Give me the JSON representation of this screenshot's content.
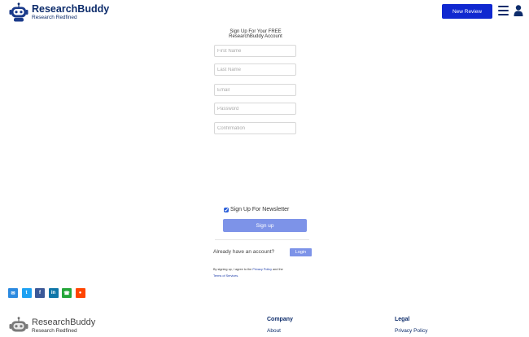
{
  "header": {
    "brand_name": "ResearchBuddy",
    "brand_tagline": "Research Redfined",
    "new_review_label": "New Review",
    "icons": [
      "robot-logo-icon",
      "hamburger-menu-icon",
      "user-icon"
    ]
  },
  "form": {
    "title_line1": "Sign Up For Your FREE",
    "title_line2": "ResearchBuddy Account",
    "fields": {
      "first_name": "First Name",
      "last_name": "Last Name",
      "email": "Email",
      "password": "Password",
      "confirmation": "Confirmation"
    },
    "newsletter_label": "Sign Up For Newsletter",
    "newsletter_checked": true,
    "signup_label": "Sign up",
    "have_account": "Already have an account?",
    "login_label": "Login",
    "terms_prefix": "By signing up, I agree to the",
    "privacy_link": "Privacy Policy",
    "terms_and": "and the",
    "terms_link": "Terms of Services."
  },
  "social": [
    {
      "name": "email",
      "glyph": "✉",
      "color": "#2c8ae0"
    },
    {
      "name": "twitter",
      "glyph": "t",
      "color": "#1da1f2"
    },
    {
      "name": "facebook",
      "glyph": "f",
      "color": "#3b5998"
    },
    {
      "name": "linkedin",
      "glyph": "in",
      "color": "#0e76a8"
    },
    {
      "name": "whatsapp",
      "glyph": "☎",
      "color": "#25a63a"
    },
    {
      "name": "reddit",
      "glyph": "●",
      "color": "#ff4500"
    }
  ],
  "footer": {
    "brand_name": "ResearchBuddy",
    "brand_tagline": "Research Redfined",
    "company_heading": "Company",
    "company_link": "About",
    "legal_heading": "Legal",
    "legal_link": "Privacy Policy"
  }
}
